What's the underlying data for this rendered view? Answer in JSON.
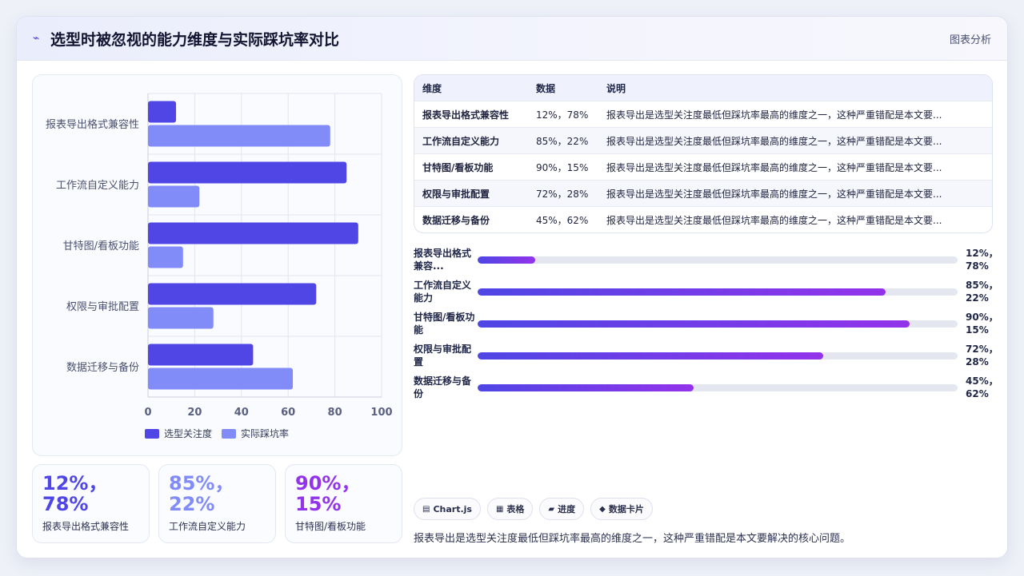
{
  "header": {
    "icon": "chart-icon",
    "title": "选型时被忽视的能力维度与实际踩坑率对比",
    "tag": "图表分析"
  },
  "chart_data": {
    "type": "bar",
    "orientation": "horizontal",
    "categories": [
      "报表导出格式兼容性",
      "工作流自定义能力",
      "甘特图/看板功能",
      "权限与审批配置",
      "数据迁移与备份"
    ],
    "series": [
      {
        "name": "选型关注度",
        "values": [
          12,
          85,
          90,
          72,
          45
        ],
        "color": "#4f46e5"
      },
      {
        "name": "实际踩坑率",
        "values": [
          78,
          22,
          15,
          28,
          62
        ],
        "color": "#818cf8"
      }
    ],
    "xlim": [
      0,
      100
    ],
    "xticks": [
      "0",
      "20",
      "40",
      "60",
      "80",
      "100"
    ],
    "grid": true,
    "legend": "bottom"
  },
  "table": {
    "headers": [
      "维度",
      "数据",
      "说明"
    ],
    "rows": [
      {
        "name": "报表导出格式兼容性",
        "value": "12%，78%",
        "desc": "报表导出是选型关注度最低但踩坑率最高的维度之一，这种严重错配是本文要..."
      },
      {
        "name": "工作流自定义能力",
        "value": "85%，22%",
        "desc": "报表导出是选型关注度最低但踩坑率最高的维度之一，这种严重错配是本文要..."
      },
      {
        "name": "甘特图/看板功能",
        "value": "90%，15%",
        "desc": "报表导出是选型关注度最低但踩坑率最高的维度之一，这种严重错配是本文要..."
      },
      {
        "name": "权限与审批配置",
        "value": "72%，28%",
        "desc": "报表导出是选型关注度最低但踩坑率最高的维度之一，这种严重错配是本文要..."
      },
      {
        "name": "数据迁移与备份",
        "value": "45%，62%",
        "desc": "报表导出是选型关注度最低但踩坑率最高的维度之一，这种严重错配是本文要..."
      }
    ]
  },
  "progress": [
    {
      "label": "报表导出格式兼容...",
      "value": "12%，\n78%",
      "pct": 12
    },
    {
      "label": "工作流自定义能力",
      "value": "85%，\n22%",
      "pct": 85
    },
    {
      "label": "甘特图/看板功能",
      "value": "90%，\n15%",
      "pct": 90
    },
    {
      "label": "权限与审批配置",
      "value": "72%，\n28%",
      "pct": 72
    },
    {
      "label": "数据迁移与备份",
      "value": "45%，\n62%",
      "pct": 45
    }
  ],
  "stats": [
    {
      "value": "12%，\n78%",
      "label": "报表导出格式兼容性",
      "color": "#4f46e5"
    },
    {
      "value": "85%，\n22%",
      "label": "工作流自定义能力",
      "color": "#818cf8"
    },
    {
      "value": "90%，\n15%",
      "label": "甘特图/看板功能",
      "color": "#9333ea"
    }
  ],
  "chips": [
    {
      "icon": "chart-icon",
      "glyph": "▤",
      "label": "Chart.js"
    },
    {
      "icon": "table-icon",
      "glyph": "▦",
      "label": "表格"
    },
    {
      "icon": "progress-icon",
      "glyph": "▰",
      "label": "进度"
    },
    {
      "icon": "card-icon",
      "glyph": "◆",
      "label": "数据卡片"
    }
  ],
  "summary": "报表导出是选型关注度最低但踩坑率最高的维度之一，这种严重错配是本文要解决的核心问题。"
}
